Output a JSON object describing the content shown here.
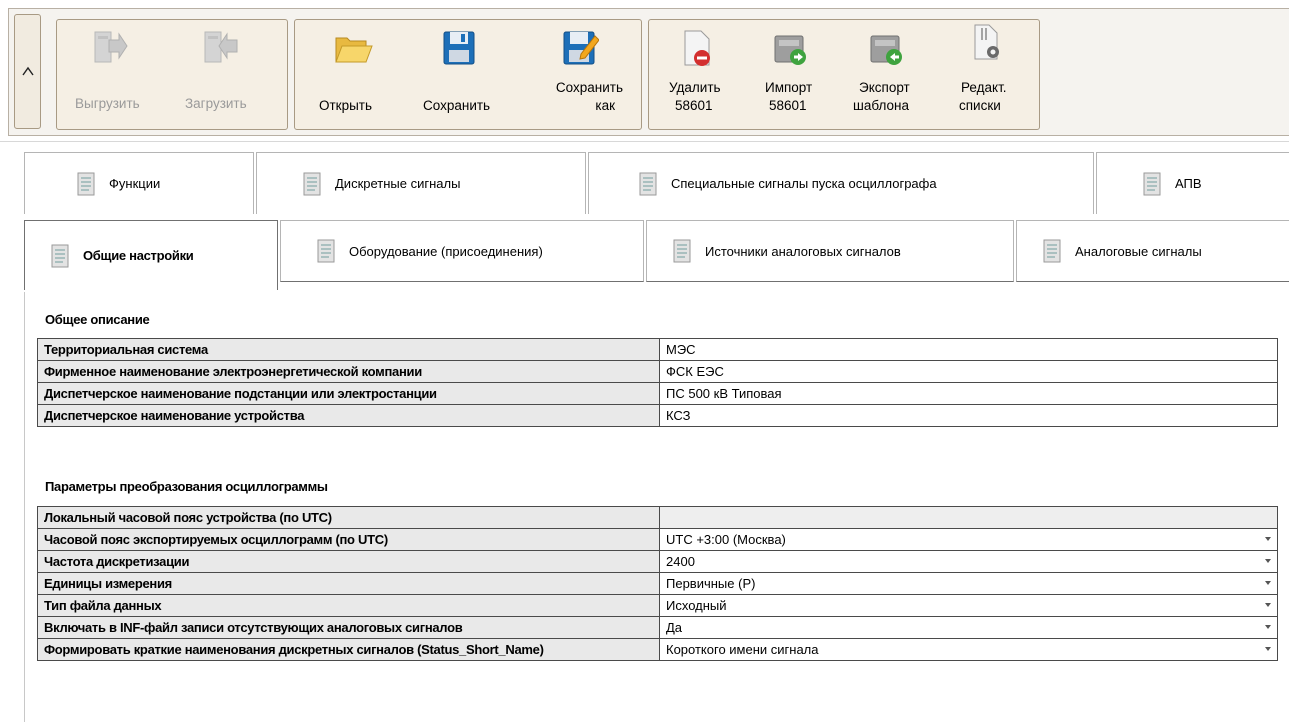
{
  "ribbon": {
    "collapse_glyph": "^",
    "buttons": [
      {
        "label": "Выгрузить",
        "icon": "upload-icon",
        "enabled": false
      },
      {
        "label": "Загрузить",
        "icon": "download-icon",
        "enabled": false
      },
      {
        "label": "Открыть",
        "icon": "folder-open-icon",
        "enabled": true
      },
      {
        "label": "Сохранить",
        "icon": "floppy-disk-icon",
        "enabled": true
      },
      {
        "label1": "Сохранить",
        "label2": "как",
        "icon": "floppy-disk-edit-icon",
        "enabled": true
      },
      {
        "label1": "Удалить",
        "label2": "58601",
        "icon": "delete-document-icon",
        "enabled": true
      },
      {
        "label1": "Импорт",
        "label2": "58601",
        "icon": "import-icon",
        "enabled": true
      },
      {
        "label1": "Экспорт",
        "label2": "шаблона",
        "icon": "export-template-icon",
        "enabled": true
      },
      {
        "label1": "Редакт.",
        "label2": "списки",
        "icon": "edit-lists-icon",
        "enabled": true
      }
    ]
  },
  "tabs_row1": [
    "Функции",
    "Дискретные сигналы",
    "Специальные сигналы пуска осциллографа",
    "АПВ"
  ],
  "tabs_row2": [
    "Общие настройки",
    "Оборудование (присоединения)",
    "Источники аналоговых сигналов",
    "Аналоговые сигналы"
  ],
  "active_tab": "Общие настройки",
  "general": {
    "title": "Общее описание",
    "rows": [
      {
        "key": "Территориальная система",
        "value": "МЭС"
      },
      {
        "key": "Фирменное наименование электроэнергетической компании",
        "value": "ФСК ЕЭС"
      },
      {
        "key": "Диспетчерское наименование подстанции или электростанции",
        "value": "ПС 500 кВ Типовая"
      },
      {
        "key": "Диспетчерское наименование устройства",
        "value": "КСЗ"
      }
    ]
  },
  "conversion": {
    "title": "Параметры преобразования осциллограммы",
    "rows": [
      {
        "key": "Локальный часовой пояс устройства (по UTC)",
        "value": ""
      },
      {
        "key": "Часовой пояс экспортируемых осциллограмм (по UTC)",
        "value": "UTC +3:00 (Москва)"
      },
      {
        "key": "Частота дискретизации",
        "value": "2400"
      },
      {
        "key": "Единицы измерения",
        "value": "Первичные (P)"
      },
      {
        "key": "Тип файла данных",
        "value": "Исходный"
      },
      {
        "key": "Включать в INF-файл записи отсутствующих аналоговых сигналов",
        "value": "Да"
      },
      {
        "key": "Формировать краткие наименования дискретных сигналов (Status_Short_Name)",
        "value": "Короткого имени сигнала"
      }
    ]
  }
}
